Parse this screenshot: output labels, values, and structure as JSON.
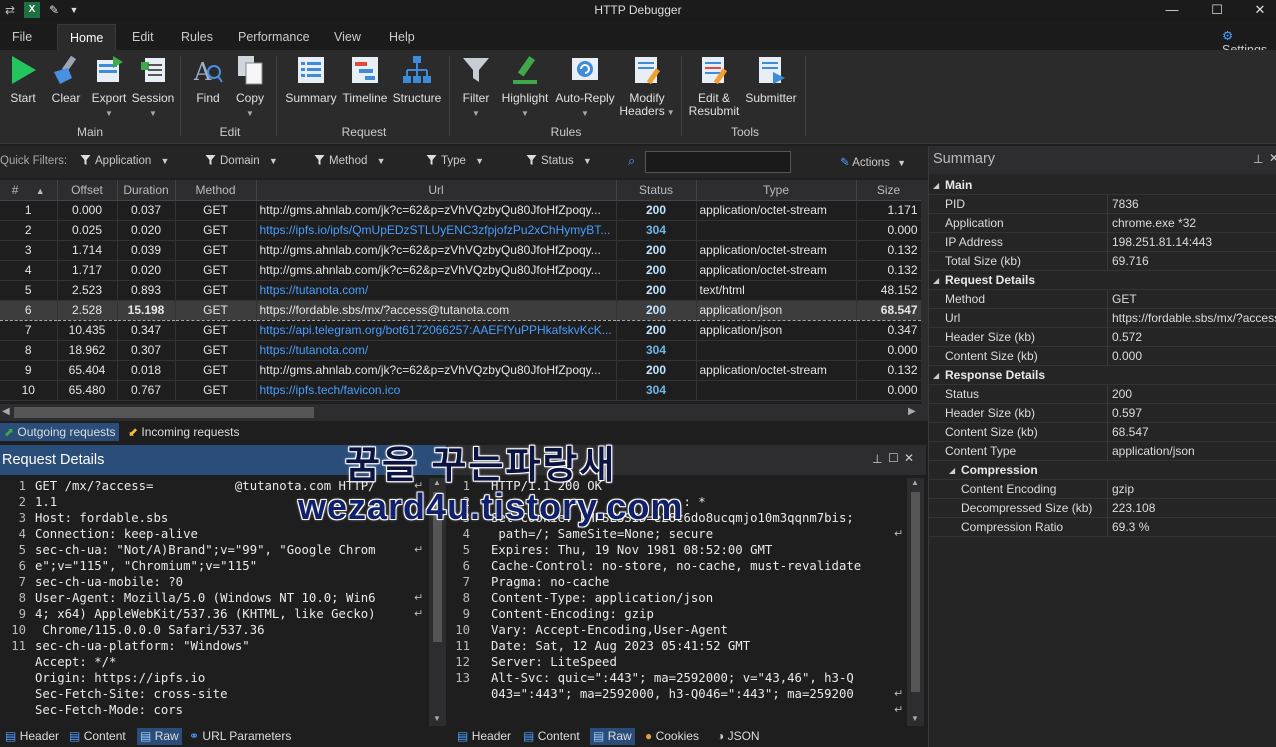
{
  "window": {
    "title": "HTTP Debugger",
    "settings_label": "Settings"
  },
  "menu": [
    "File",
    "Home",
    "Edit",
    "Rules",
    "Performance",
    "View",
    "Help"
  ],
  "ribbon": {
    "buttons": [
      {
        "label": "Start"
      },
      {
        "label": "Clear"
      },
      {
        "label": "Export"
      },
      {
        "label": "Session"
      },
      {
        "label": "Find"
      },
      {
        "label": "Copy"
      },
      {
        "label": "Summary"
      },
      {
        "label": "Timeline"
      },
      {
        "label": "Structure"
      },
      {
        "label": "Filter"
      },
      {
        "label": "Highlight"
      },
      {
        "label": "Auto-Reply"
      },
      {
        "label": "Modify Headers"
      },
      {
        "label": "Edit & Resubmit"
      },
      {
        "label": "Submitter"
      }
    ],
    "groups": [
      "Main",
      "Edit",
      "Request",
      "Rules",
      "Tools"
    ]
  },
  "quick_filters": {
    "label": "Quick Filters:",
    "items": [
      "Application",
      "Domain",
      "Method",
      "Type",
      "Status"
    ],
    "actions_label": "Actions"
  },
  "grid": {
    "columns": [
      "#",
      "Offset",
      "Duration",
      "Method",
      "Url",
      "Status",
      "Type",
      "Size"
    ],
    "rows": [
      {
        "n": "1",
        "offset": "0.000",
        "duration": "0.037",
        "method": "GET",
        "url": "http://gms.ahnlab.com/jk?c=62&p=zVhVQzbyQu80JfoHfZpoqy...",
        "status": "200",
        "type": "application/octet-stream",
        "size": "1.171",
        "link": false
      },
      {
        "n": "2",
        "offset": "0.025",
        "duration": "0.020",
        "method": "GET",
        "url": "https://ipfs.io/ipfs/QmUpEDzSTLUyENC3zfpjofzPu2xChHymyBT...",
        "status": "304",
        "type": "",
        "size": "0.000",
        "link": true
      },
      {
        "n": "3",
        "offset": "1.714",
        "duration": "0.039",
        "method": "GET",
        "url": "http://gms.ahnlab.com/jk?c=62&p=zVhVQzbyQu80JfoHfZpoqy...",
        "status": "200",
        "type": "application/octet-stream",
        "size": "0.132",
        "link": false
      },
      {
        "n": "4",
        "offset": "1.717",
        "duration": "0.020",
        "method": "GET",
        "url": "http://gms.ahnlab.com/jk?c=62&p=zVhVQzbyQu80JfoHfZpoqy...",
        "status": "200",
        "type": "application/octet-stream",
        "size": "0.132",
        "link": false
      },
      {
        "n": "5",
        "offset": "2.523",
        "duration": "0.893",
        "method": "GET",
        "url": "https://tutanota.com/",
        "status": "200",
        "type": "text/html",
        "size": "48.152",
        "link": true
      },
      {
        "n": "6",
        "offset": "2.528",
        "duration": "15.198",
        "method": "GET",
        "url": "https://fordable.sbs/mx/?access@tutanota.com",
        "status": "200",
        "type": "application/json",
        "size": "68.547",
        "link": false,
        "selected": true
      },
      {
        "n": "7",
        "offset": "10.435",
        "duration": "0.347",
        "method": "GET",
        "url": "https://api.telegram.org/bot6172066257:AAEFfYuPPHkafskvKcK...",
        "status": "200",
        "type": "application/json",
        "size": "0.347",
        "link": true
      },
      {
        "n": "8",
        "offset": "18.962",
        "duration": "0.307",
        "method": "GET",
        "url": "https://tutanota.com/",
        "status": "304",
        "type": "",
        "size": "0.000",
        "link": true
      },
      {
        "n": "9",
        "offset": "65.404",
        "duration": "0.018",
        "method": "GET",
        "url": "http://gms.ahnlab.com/jk?c=62&p=zVhVQzbyQu80JfoHfZpoqy...",
        "status": "200",
        "type": "application/octet-stream",
        "size": "0.132",
        "link": false
      },
      {
        "n": "10",
        "offset": "65.480",
        "duration": "0.767",
        "method": "GET",
        "url": "https://ipfs.tech/favicon.ico",
        "status": "304",
        "type": "",
        "size": "0.000",
        "link": true
      }
    ]
  },
  "request_tabs": [
    "Outgoing requests",
    "Incoming requests"
  ],
  "request_pane": {
    "title": "Request Details",
    "lines": [
      {
        "n": "1",
        "t": "GET /mx/?access=           @tutanota.com HTTP/"
      },
      {
        "n": "",
        "t": "1.1"
      },
      {
        "n": "2",
        "t": "Host: fordable.sbs"
      },
      {
        "n": "3",
        "t": "Connection: keep-alive"
      },
      {
        "n": "4",
        "t": "sec-ch-ua: \"Not/A)Brand\";v=\"99\", \"Google Chrom"
      },
      {
        "n": "",
        "t": "e\";v=\"115\", \"Chromium\";v=\"115\""
      },
      {
        "n": "5",
        "t": "sec-ch-ua-mobile: ?0"
      },
      {
        "n": "6",
        "t": "User-Agent: Mozilla/5.0 (Windows NT 10.0; Win6"
      },
      {
        "n": "",
        "t": "4; x64) AppleWebKit/537.36 (KHTML, like Gecko)"
      },
      {
        "n": "",
        "t": " Chrome/115.0.0.0 Safari/537.36"
      },
      {
        "n": "7",
        "t": "sec-ch-ua-platform: \"Windows\""
      },
      {
        "n": "8",
        "t": "Accept: */*"
      },
      {
        "n": "9",
        "t": "Origin: https://ipfs.io"
      },
      {
        "n": "10",
        "t": "Sec-Fetch-Site: cross-site"
      },
      {
        "n": "11",
        "t": "Sec-Fetch-Mode: cors"
      }
    ],
    "tabs": [
      "Header",
      "Content",
      "Raw",
      "URL Parameters"
    ]
  },
  "response_pane": {
    "lines": [
      {
        "n": "1",
        "t": "HTTP/1.1 200 OK"
      },
      {
        "n": "2",
        "t": ""
      },
      {
        "n": "3",
        "t": "                          : *"
      },
      {
        "n": "4",
        "t": "Set-Cookie: PHPSESSID=e28c6do8ucqmjo10m3qqnm7bis;"
      },
      {
        "n": "",
        "t": " path=/; SameSite=None; secure"
      },
      {
        "n": "5",
        "t": "Expires: Thu, 19 Nov 1981 08:52:00 GMT"
      },
      {
        "n": "6",
        "t": "Cache-Control: no-store, no-cache, must-revalidate"
      },
      {
        "n": "7",
        "t": "Pragma: no-cache"
      },
      {
        "n": "8",
        "t": "Content-Type: application/json"
      },
      {
        "n": "9",
        "t": "Content-Encoding: gzip"
      },
      {
        "n": "10",
        "t": "Vary: Accept-Encoding,User-Agent"
      },
      {
        "n": "11",
        "t": "Date: Sat, 12 Aug 2023 05:41:52 GMT"
      },
      {
        "n": "12",
        "t": "Server: LiteSpeed"
      },
      {
        "n": "13",
        "t": "Alt-Svc: quic=\":443\"; ma=2592000; v=\"43,46\", h3-Q"
      },
      {
        "n": "",
        "t": "043=\":443\"; ma=2592000, h3-Q046=\":443\"; ma=259200"
      }
    ],
    "tabs": [
      "Header",
      "Content",
      "Raw",
      "Cookies",
      "JSON"
    ]
  },
  "summary": {
    "title": "Summary",
    "sections": [
      {
        "name": "Main",
        "rows": [
          [
            "PID",
            "7836"
          ],
          [
            "Application",
            "chrome.exe *32"
          ],
          [
            "IP Address",
            "198.251.81.14:443"
          ],
          [
            "Total Size (kb)",
            "69.716"
          ]
        ]
      },
      {
        "name": "Request Details",
        "rows": [
          [
            "Method",
            "GET"
          ],
          [
            "Url",
            "https://fordable.sbs/mx/?access"
          ],
          [
            "Header Size (kb)",
            "0.572"
          ],
          [
            "Content Size (kb)",
            "0.000"
          ]
        ]
      },
      {
        "name": "Response Details",
        "rows": [
          [
            "Status",
            "200"
          ],
          [
            "Header Size (kb)",
            "0.597"
          ],
          [
            "Content Size (kb)",
            "68.547"
          ],
          [
            "Content Type",
            "application/json"
          ]
        ]
      },
      {
        "name": "Compression",
        "rows": [
          [
            "Content Encoding",
            "gzip"
          ],
          [
            "Decompressed Size (kb)",
            "223.108"
          ],
          [
            "Compression Ratio",
            "69.3 %"
          ]
        ]
      }
    ]
  },
  "watermark": {
    "line1": "꿈을 꾸는파랑새",
    "line2": "wezard4u.tistory.com"
  },
  "colors": {
    "accent": "#2a4d7a",
    "link": "#4a9eff",
    "start_green": "#22c55e"
  }
}
